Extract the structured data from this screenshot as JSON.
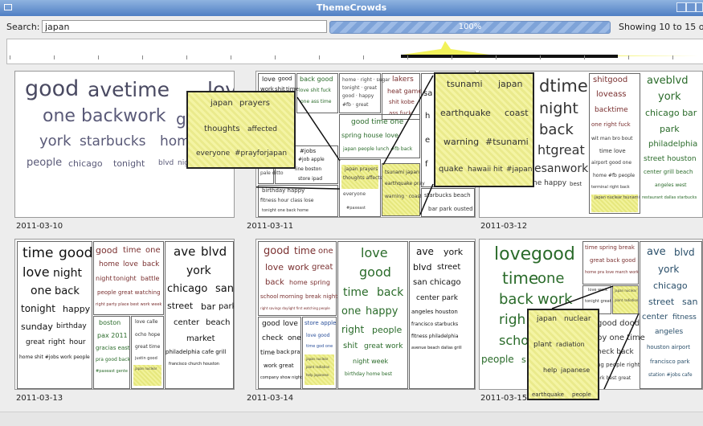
{
  "window": {
    "title": "ThemeCrowds"
  },
  "search": {
    "label": "Search:",
    "value": "japan",
    "progress": "100%",
    "showing": "Showing 10 to 15 of 17"
  },
  "panels": [
    {
      "date": "2011-03-10"
    },
    {
      "date": "2011-03-11"
    },
    {
      "date": "2011-03-12"
    },
    {
      "date": "2011-03-13"
    },
    {
      "date": "2011-03-14"
    },
    {
      "date": "2011-03-15"
    }
  ],
  "p1": {
    "w1": "good",
    "w2": "avetime",
    "w3": "love",
    "w4": "one",
    "w5": "backwork",
    "w6": "g",
    "w7": "york",
    "w8": "starbucks",
    "w9": "home",
    "w10": "people",
    "w11": "chicago",
    "w12": "tonight",
    "w13": "blvd",
    "w14": "nigh"
  },
  "p2": {
    "c1a": "love",
    "c1b": "good",
    "c2a": "work",
    "c2b": "shit",
    "c2c": "time",
    "c3": "back good",
    "c4": "love shit fuck",
    "c5": "one ass time",
    "c6": "lakers",
    "c7": "heat game",
    "c8": "shit kobe",
    "c9": "ass fuck",
    "c10": "good time one",
    "c11": "spring house love",
    "c12": "japan people lunch #fb back",
    "c13": "sa",
    "c14": "h",
    "c15": "e",
    "c16": "f",
    "c17": "starbucks beach",
    "c18": "bar park ousted",
    "c19": "nyc",
    "c20": "#jobs",
    "c21": "#job apple",
    "c22": "line boston",
    "c23": "store ipad",
    "c24": "birthday happy",
    "c25": "fitness hour class lose",
    "c26": "tonight one back home",
    "c27": "#paxeast",
    "c28": "tsunami japan",
    "c29": "earthquake pray",
    "popup1": {
      "w1": "japan",
      "w2": "prayers",
      "w3": "thoughts",
      "w4": "affected",
      "w5": "everyone",
      "w6": "#prayforjapan"
    }
  },
  "p3": {
    "w1": "dtime",
    "w2": "night",
    "w3": "back",
    "w4": "htgreat",
    "w5": "esanwork",
    "w6": "he happy",
    "w7": "best",
    "m1": "shitgood",
    "m2": "loveass",
    "m3": "backtime",
    "m4": "one right fuck",
    "m5": "wit man bro bout",
    "m6": "time love",
    "m7": "airport good one",
    "m8": "home #fb people",
    "m9": "terminal right back",
    "m10": "japan nuclear tsunami",
    "r1": "aveblvd",
    "r2": "york",
    "r3": "chicago bar",
    "r4": "park",
    "r5": "philadelphia",
    "r6": "street houston",
    "r7": "center grill beach",
    "r8": "angeles west",
    "r9": "restaurant dallas starbucks",
    "popup2": {
      "w1": "tsunami",
      "w2": "japan",
      "w3": "earthquake",
      "w4": "coast",
      "w5": "warning",
      "w6": "#tsunami",
      "w7": "quake",
      "w8": "hawaii",
      "w9": "hit",
      "w10": "#japan"
    }
  },
  "p4": {
    "a1": "time",
    "a2": "good",
    "a3": "love",
    "a4": "night",
    "a5": "one",
    "a6": "back",
    "a7": "tonight",
    "a8": "happy",
    "a9": "sunday",
    "a10": "birthday",
    "a11": "great",
    "a12": "right",
    "a13": "hour",
    "a14": "home shit #jobs work people",
    "b1": "good",
    "b2": "time",
    "b3": "one",
    "b4": "home",
    "b5": "love",
    "b6": "back",
    "b7": "night",
    "b8": "tonight",
    "b9": "battle",
    "b10": "people great watching",
    "b11": "right party place best work week",
    "c1": "boston",
    "c2": "pax 2011",
    "c3": "gracias east",
    "c4": "pra good back",
    "c5": "#paxeast gente",
    "c6": "love calle",
    "c7": "ocho hope",
    "c8": "great time",
    "c9": "justin good",
    "c10": "japan nuclear",
    "d1": "ave",
    "d2": "blvd",
    "d3": "york",
    "d4": "chicago",
    "d5": "san",
    "d6": "street",
    "d7": "bar",
    "d8": "park",
    "d9": "center",
    "d10": "beach",
    "d11": "market",
    "d12": "philadelphia cafe grill",
    "d13": "francisco church houston"
  },
  "p5": {
    "a1": "good",
    "a2": "time",
    "a3": "one",
    "a4": "love",
    "a5": "work",
    "a6": "great",
    "a7": "back",
    "a8": "home",
    "a9": "spring",
    "a10": "school",
    "a11": "morning",
    "a12": "break",
    "a13": "night",
    "a14": "right savings daylight first watching people",
    "b1": "good",
    "b2": "love",
    "b3": "check",
    "b4": "one",
    "b5": "time",
    "b6": "back",
    "b7": "pra",
    "b8": "work great",
    "b9": "company show night",
    "b10": "store",
    "b11": "apple",
    "b12": "love good",
    "b13": "time god one",
    "c1": "love",
    "c2": "good",
    "c3": "time",
    "c4": "back",
    "c5": "one",
    "c6": "happy",
    "c7": "right",
    "c8": "people",
    "c9": "shit",
    "c10": "great work",
    "c11": "night week",
    "c12": "birthday home best",
    "d1": "ave",
    "d2": "york",
    "d3": "blvd",
    "d4": "street",
    "d5": "san chicago",
    "d6": "center park",
    "d7": "angeles houston",
    "d8": "francisco starbucks",
    "d9": "fitness philadelphia",
    "d10": "avenue beach dallas grill"
  },
  "p6": {
    "a1": "love",
    "a2": "good",
    "a3": "time",
    "a4": "one",
    "a5": "back",
    "a6": "work",
    "a7": "righ",
    "a8": "scho",
    "a9": "people",
    "a10": "s",
    "b1": "time spring break",
    "b2": "great back good",
    "b3": "home pra love march work",
    "b4": "love work",
    "b5": "tonight great",
    "b6": "good dood",
    "b7": "py one time",
    "b8": "heck back",
    "b9": "ng people right",
    "b10": "ork best great",
    "d1": "ave",
    "d2": "blvd",
    "d3": "york",
    "d4": "chicago",
    "d5": "street",
    "d6": "san",
    "d7": "center",
    "d8": "fitness",
    "d9": "angeles",
    "d10": "houston airport",
    "d11": "francisco park",
    "d12": "station #jobs cafe",
    "popup3": {
      "w1": "japan",
      "w2": "nuclear",
      "w3": "plant",
      "w4": "radiation",
      "w5": "help",
      "w6": "japanese",
      "w7": "earthquake",
      "w8": "people"
    }
  }
}
